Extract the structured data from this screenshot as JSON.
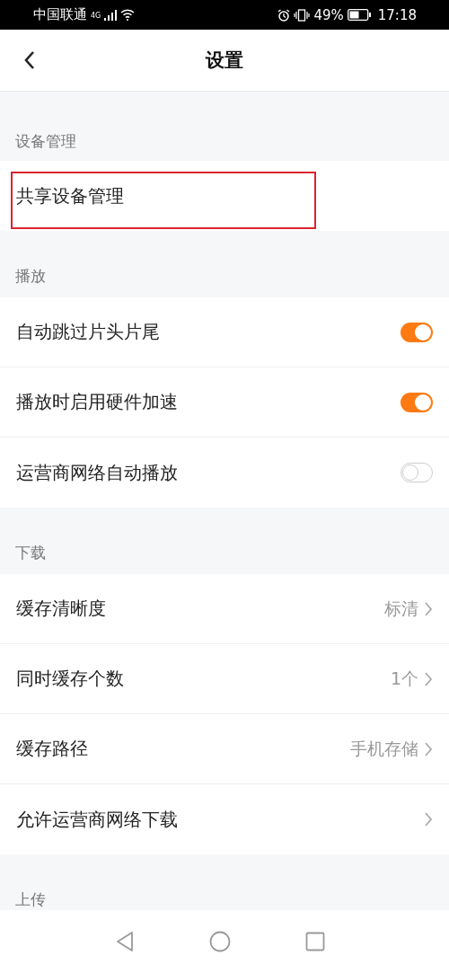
{
  "status_bar": {
    "carrier": "中国联通",
    "network": "4G",
    "battery": "49%",
    "time": "17:18"
  },
  "header": {
    "title": "设置"
  },
  "sections": [
    {
      "title": "设备管理",
      "rows": [
        {
          "kind": "plain",
          "label": "共享设备管理",
          "highlighted": true
        }
      ]
    },
    {
      "title": "播放",
      "rows": [
        {
          "kind": "toggle",
          "label": "自动跳过片头片尾",
          "on": true
        },
        {
          "kind": "toggle",
          "label": "播放时启用硬件加速",
          "on": true
        },
        {
          "kind": "toggle",
          "label": "运营商网络自动播放",
          "on": false
        }
      ]
    },
    {
      "title": "下载",
      "rows": [
        {
          "kind": "value",
          "label": "缓存清晰度",
          "value": "标清"
        },
        {
          "kind": "value",
          "label": "同时缓存个数",
          "value": "1个"
        },
        {
          "kind": "value",
          "label": "缓存路径",
          "value": "手机存储"
        },
        {
          "kind": "link",
          "label": "允许运营商网络下载"
        }
      ]
    },
    {
      "title": "上传"
    }
  ]
}
